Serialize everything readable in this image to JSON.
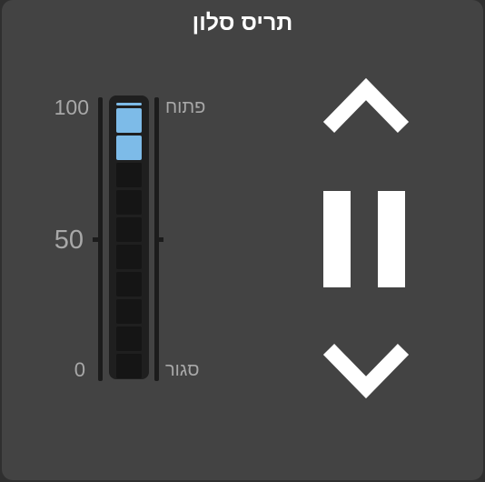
{
  "card": {
    "title": "תריס סלון"
  },
  "scale": {
    "max_label": "100",
    "mid_label": "50",
    "min_label": "0",
    "open_label": "פתוח",
    "closed_label": "סגור"
  },
  "position": {
    "percent": 90,
    "segments_total": 10,
    "segments_lit": 2
  },
  "controls": {
    "up_icon": "chevron-up-icon",
    "stop_icon": "pause-icon",
    "down_icon": "chevron-down-icon"
  },
  "colors": {
    "card_bg": "#434343",
    "segment_on": "#7dbbe8",
    "segment_off": "#151515",
    "icon": "#ffffff",
    "scale_text": "#a8a8a8"
  }
}
